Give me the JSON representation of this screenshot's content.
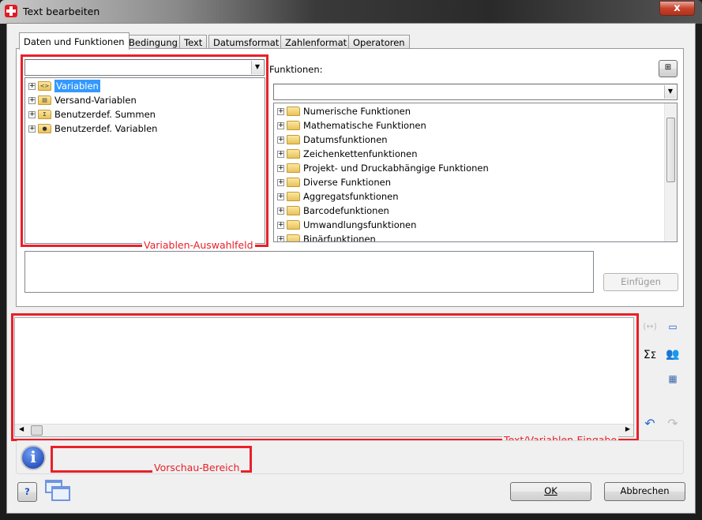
{
  "window": {
    "title": "Text bearbeiten",
    "close_label": "x"
  },
  "tabs": [
    {
      "label": "Daten und Funktionen",
      "active": true
    },
    {
      "label": "Bedingung"
    },
    {
      "label": "Text"
    },
    {
      "label": "Datumsformat"
    },
    {
      "label": "Zahlenformat"
    },
    {
      "label": "Operatoren"
    }
  ],
  "variables": {
    "combo_value": "",
    "items": [
      {
        "label": "Variablen",
        "selected": true,
        "icon": "variables-folder-icon"
      },
      {
        "label": "Versand-Variablen",
        "icon": "printer-folder-icon"
      },
      {
        "label": "Benutzerdef. Summen",
        "icon": "sum-folder-icon"
      },
      {
        "label": "Benutzerdef. Variablen",
        "icon": "user-folder-icon"
      }
    ]
  },
  "functions": {
    "label": "Funktionen:",
    "combo_value": "",
    "items": [
      "Numerische Funktionen",
      "Mathematische Funktionen",
      "Datumsfunktionen",
      "Zeichenkettenfunktionen",
      "Projekt- und Druckabhängige Funktionen",
      "Diverse Funktionen",
      "Aggregatsfunktionen",
      "Barcodefunktionen",
      "Umwandlungsfunktionen",
      "Binärfunktionen"
    ]
  },
  "insert_button": "Einfügen",
  "editor": {
    "value": ""
  },
  "annotations": {
    "variables_field": "Variablen-Auswahlfeld",
    "text_input": "Text/Variablen-Eingabe",
    "preview": "Vorschau-Bereich"
  },
  "buttons": {
    "ok": "OK",
    "cancel": "Abbrechen"
  },
  "colors": {
    "annotation": "#e8202a",
    "selection": "#3399ff"
  }
}
